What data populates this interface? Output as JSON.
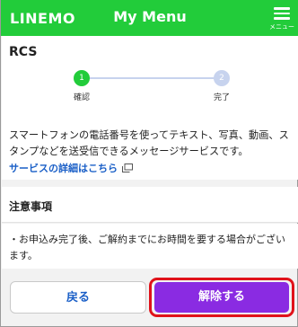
{
  "header": {
    "logo": "LINEMO",
    "title": "My Menu",
    "menu_label": "メニュー"
  },
  "service": {
    "name": "RCS",
    "steps": [
      {
        "number": "1",
        "label": "確認",
        "state": "active"
      },
      {
        "number": "2",
        "label": "完了",
        "state": "inactive"
      }
    ],
    "description": "スマートフォンの電話番号を使ってテキスト、写真、動画、スタンプなどを送受信できるメッセージサービスです。",
    "details_link": "サービスの詳細はこちら"
  },
  "notes": {
    "title": "注意事項",
    "items": [
      "・お申込み完了後、ご解約までにお時間を要する場合がございます。"
    ]
  },
  "buttons": {
    "back": "戻る",
    "cancel": "解除する"
  },
  "colors": {
    "brand_green": "#22cc3a",
    "accent_purple": "#8a2be2",
    "highlight_red": "#e0121a",
    "link_blue": "#1a5fc7"
  }
}
